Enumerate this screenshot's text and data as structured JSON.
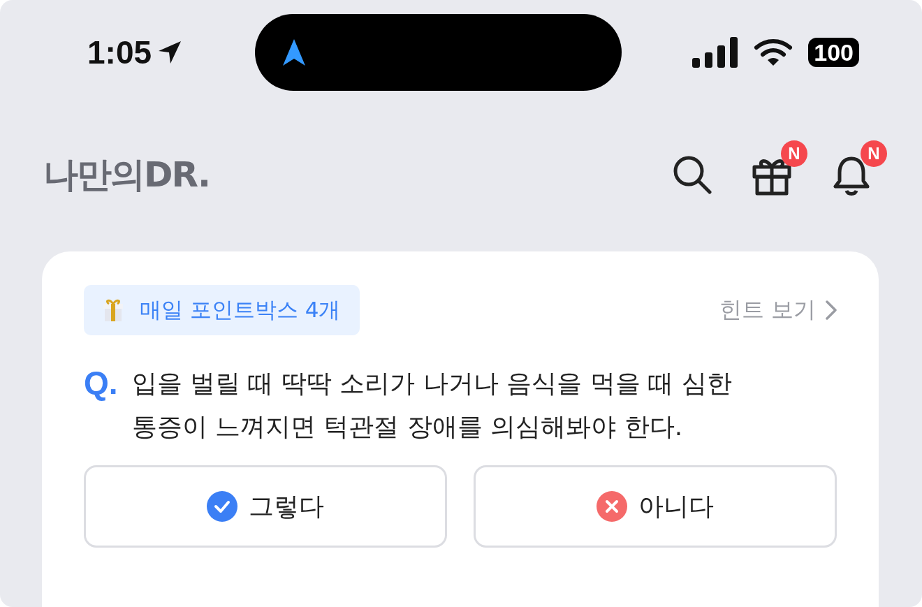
{
  "status_bar": {
    "time": "1:05",
    "battery": "100"
  },
  "header": {
    "logo": "나만의DR.",
    "icons": [
      {
        "kind": "search"
      },
      {
        "kind": "gift",
        "badge": "N"
      },
      {
        "kind": "bell",
        "badge": "N"
      }
    ]
  },
  "quiz": {
    "reward": "매일 포인트박스 4개",
    "hint": "힌트 보기",
    "q_mark": "Q.",
    "question": "입을 벌릴 때 딱딱 소리가 나거나 음식을 먹을 때 심한 통증이 느껴지면 턱관절 장애를 의심해봐야 한다.",
    "answers": [
      {
        "kind": "yes",
        "label": "그렇다"
      },
      {
        "kind": "no",
        "label": "아니다"
      }
    ]
  }
}
